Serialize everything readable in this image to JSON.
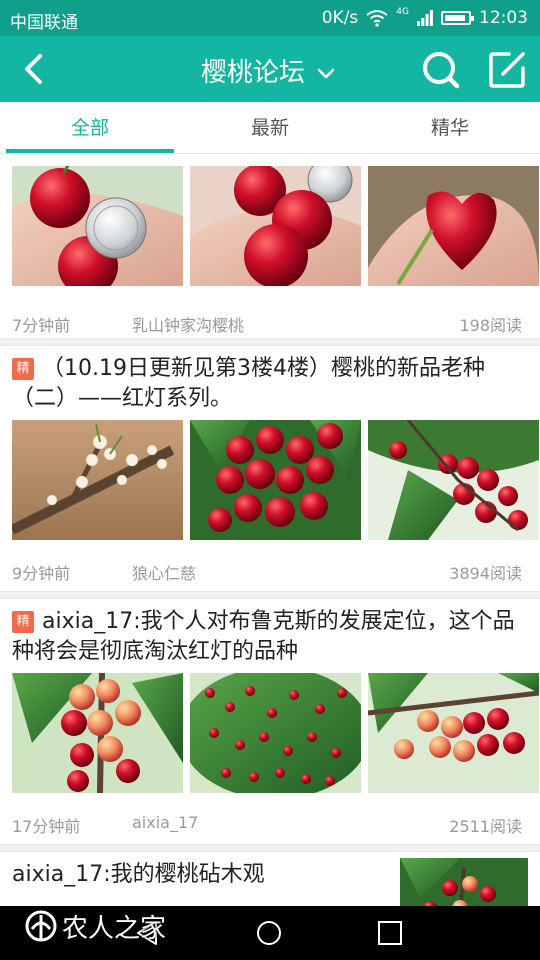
{
  "status_bar": {
    "carrier": "中国联通",
    "speed": "0K/s",
    "network": "4G",
    "time": "12:03",
    "icons": [
      "wifi-icon",
      "signal-icon",
      "battery-icon"
    ]
  },
  "app_bar": {
    "title": "樱桃论坛",
    "icons": [
      "back-arrow-icon",
      "chevron-down-icon",
      "search-icon",
      "compose-icon"
    ]
  },
  "tabs": [
    {
      "label": "全部",
      "active": true
    },
    {
      "label": "最新"
    },
    {
      "label": "精华"
    }
  ],
  "posts": [
    {
      "title": "",
      "meta": {
        "time": "7分钟前",
        "author": "乳山钟家沟樱桃",
        "reads": "198阅读"
      },
      "thumbs": [
        "cherries-with-coin-photo",
        "cherries-with-coin-photo",
        "heart-cherry-photo"
      ]
    },
    {
      "badge": "精",
      "title": "（10.19日更新见第3楼4楼）樱桃的新品老种（二）——红灯系列。",
      "meta": {
        "time": "9分钟前",
        "author": "狼心仁慈",
        "reads": "3894阅读"
      },
      "thumbs": [
        "cherry-blossom-branch-photo",
        "cherry-cluster-photo",
        "cherry-tree-photo"
      ]
    },
    {
      "badge": "精",
      "title": "aixia_17:我个人对布鲁克斯的发展定位，这个品种将会是彻底淘汰红灯的品种",
      "meta": {
        "time": "17分钟前",
        "author": "aixia_17",
        "reads": "2511阅读"
      },
      "thumbs": [
        "cherry-branch-photo",
        "cherry-tree-photo",
        "cherry-branch-photo"
      ]
    },
    {
      "title": "aixia_17:我的樱桃砧木观",
      "thumbs": [
        "cherry-tree-photo"
      ]
    }
  ],
  "watermark": {
    "text": "农人之家"
  },
  "nav_bar": {
    "icons": [
      "nav-back-icon",
      "nav-home-icon",
      "nav-recent-icon"
    ]
  },
  "colors": {
    "accent": "#13b7a1",
    "status_bar": "#0f9f8a",
    "badge": "#f26a4b",
    "meta_text": "#9a9a9a"
  }
}
